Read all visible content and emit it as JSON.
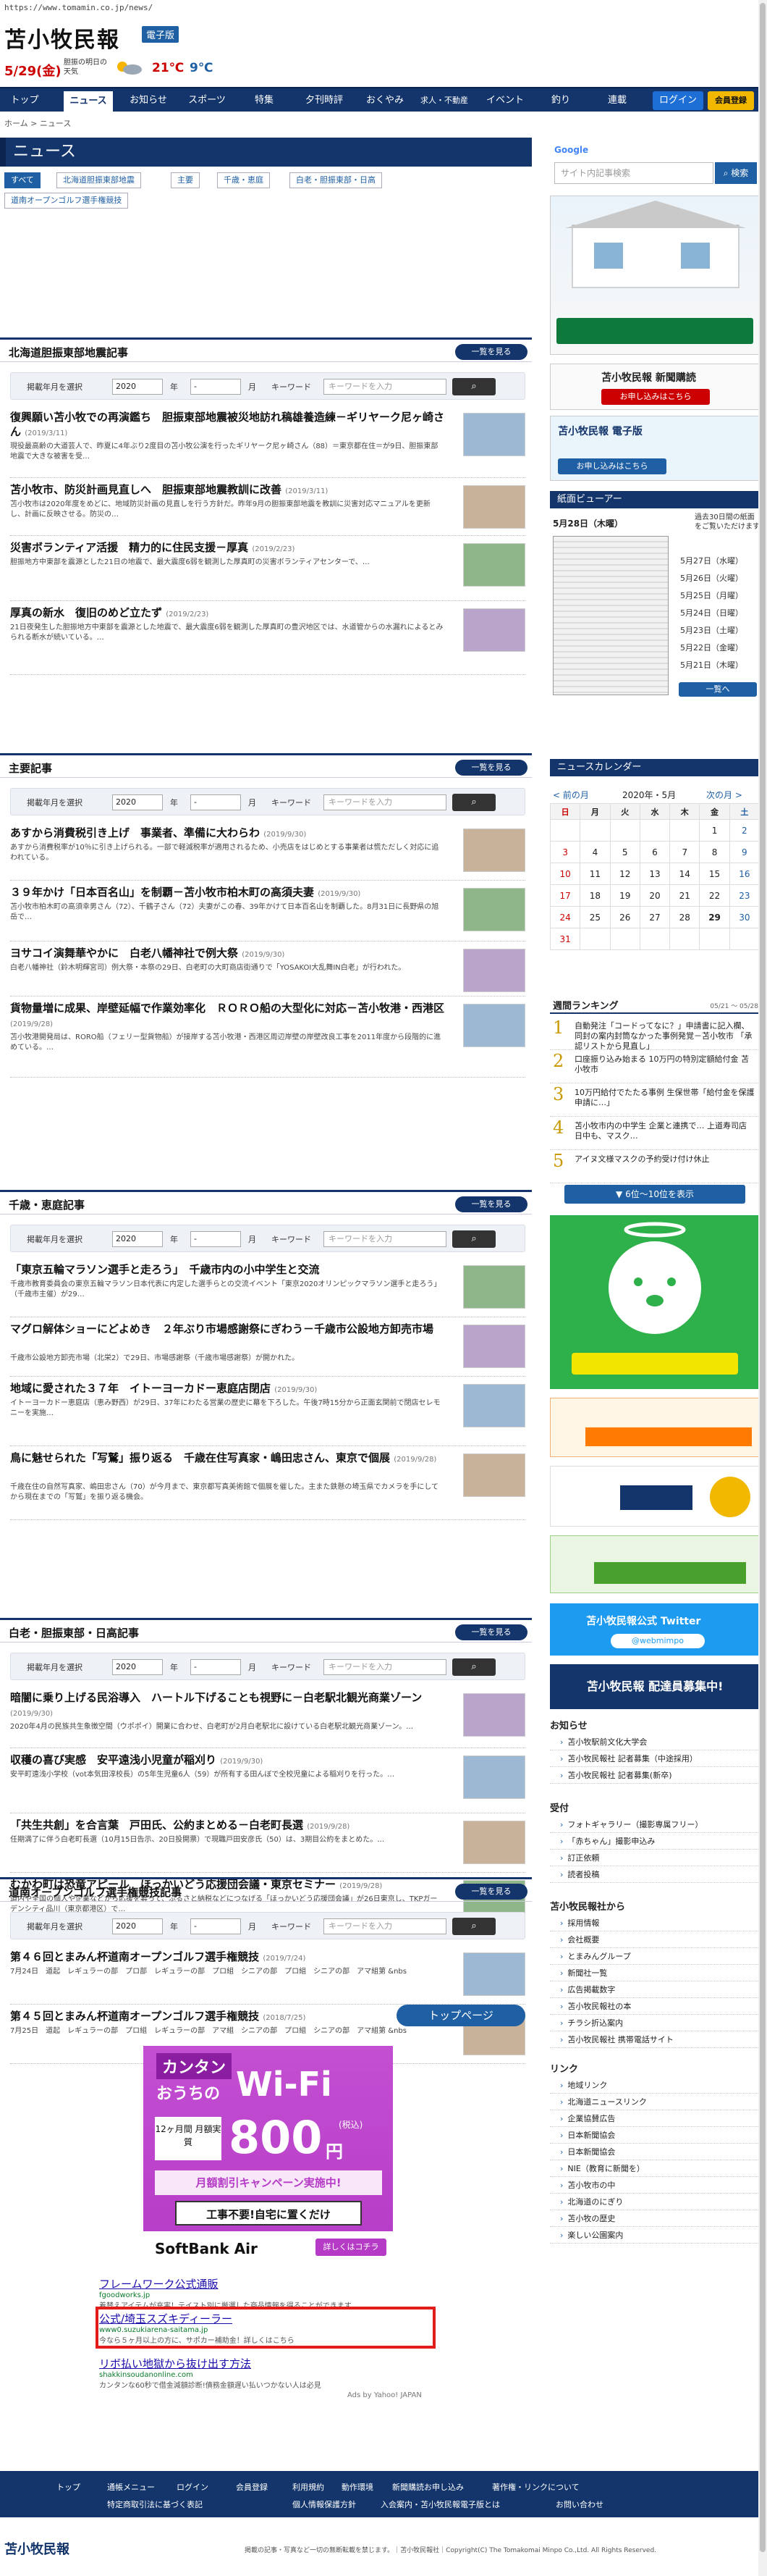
{
  "url": "https://www.tomamin.co.jp/news/",
  "header": {
    "logo": "苫小牧民報",
    "edition": "電子版",
    "date": "5/29(金)",
    "weather_label": "胆振の明日の天気",
    "temp_hi": "21℃",
    "temp_lo": "9℃"
  },
  "nav": [
    "トップ",
    "ニュース",
    "お知らせ",
    "スポーツ",
    "特集",
    "夕刊時評",
    "おくやみ",
    "求人・不動産",
    "イベント",
    "釣り",
    "連載",
    "ログイン",
    "会員登録"
  ],
  "breadcrumb": "ホーム > ニュース",
  "page_title": "ニュース",
  "categories": [
    "すべて",
    "北海道胆振東部地震",
    "主要",
    "千歳・恵庭",
    "白老・胆振東部・日高",
    "道南オープンゴルフ選手権競技"
  ],
  "search": {
    "year_label": "掲載年月を選択",
    "year": "2020",
    "year_unit": "年",
    "month": "-",
    "month_unit": "月",
    "keyword_label": "キーワード",
    "keyword_placeholder": "キーワードを入力",
    "more": "一覧を見る"
  },
  "sections": [
    {
      "title": "北海道胆振東部地震記事",
      "articles": [
        {
          "title": "復興願い苫小牧での再演鑑ち　胆振東部地震被災地訪れ稿雄養造練－ギリヤーク尼ヶ崎さん",
          "date": "(2019/3/11)",
          "body": "現役最高齢の大道芸人で、昨夏に4年ぶり2度目の苫小牧公演を行ったギリヤーク尼ヶ崎さん（88）＝東京都在住＝が9日、胆振東部地震で大きな被害を受…"
        },
        {
          "title": "苫小牧市、防災計画見直しへ　胆振東部地震教訓に改善",
          "date": "(2019/3/11)",
          "body": "苫小牧市は2020年度をめどに、地域防災計画の見直しを行う方針だ。昨年9月の胆振東部地震を教訓に災害対応マニュアルを更新し、計画に反映させる。防災の…"
        },
        {
          "title": "災害ボランティア活援　精力的に住民支援－厚真",
          "date": "(2019/2/23)",
          "body": "胆振地方中東部を震源とした21日の地震で、最大震度6弱を観測した厚真町の災害ボランティアセンターで、…"
        },
        {
          "title": "厚真の新水　復旧のめど立たず",
          "date": "(2019/2/23)",
          "body": "21日夜発生した胆振地方中東部を震源とした地震で、最大震度6弱を観測した厚真町の豊沢地区では、水道管からの水漏れによるとみられる断水が続いている。…"
        }
      ]
    },
    {
      "title": "主要記事",
      "articles": [
        {
          "title": "あすから消費税引き上げ　事業者、準備に大わらわ",
          "date": "(2019/9/30)",
          "body": "あすから消費税率が10％に引き上げられる。一部で軽減税率が適用されるため、小売店をはじめとする事業者は慌ただしく対応に追われている。"
        },
        {
          "title": "３９年かけ「日本百名山」を制覇－苫小牧市柏木町の高須夫妻",
          "date": "(2019/9/30)",
          "body": "苫小牧市柏木町の高須幸男さん（72）、千鶴子さん（72）夫妻がこの春、39年かけて日本百名山を制覇した。8月31日に長野県の旭岳で…"
        },
        {
          "title": "ヨサコイ演舞華やかに　白老八幡神社で例大祭",
          "date": "(2019/9/30)",
          "body": "白老八幡神社（鈴木明輝宮司）例大祭・本祭の29日、白老町の大町商店街通りで「YOSAKOI大乱舞IN白老」が行われた。"
        },
        {
          "title": "貨物量増に成果、岸壁延幅で作業効率化　ＲＯＲＯ船の大型化に対応－苫小牧港・西港区",
          "date": "(2019/9/28)",
          "body": "苫小牧港開発局は、RORO船（フェリー型貨物船）が接岸する苫小牧港・西港区周辺岸壁の岸壁改良工事を2011年度から段階的に進めている。…"
        }
      ]
    },
    {
      "title": "千歳・恵庭記事",
      "articles": [
        {
          "title": "「東京五輪マラソン選手と走ろう」　千歳市内の小中学生と交流",
          "date": "",
          "body": "千歳市教育委員会の東京五輪マラソン日本代表に内定した選手らとの交流イベント「東京2020オリンピックマラソン選手と走ろう」（千歳市主催）が29…"
        },
        {
          "title": "マグロ解体ショーにどよめき　２年ぶり市場感謝祭にぎわう－千歳市公設地方卸売市場",
          "date": "",
          "body": "千歳市公設地方卸売市場（北栄2）で29日、市場感謝祭（千歳市場感謝祭）が開かれた。"
        },
        {
          "title": "地域に愛された３７年　イトーヨーカドー恵庭店閉店",
          "date": "(2019/9/30)",
          "body": "イトーヨーカドー恵庭店（恵み野西）が29日、37年にわたる営業の歴史に幕を下ろした。午後7時15分から正面玄関前で閉店セレモニーを実施…"
        },
        {
          "title": "鳥に魅せられた「写鷲」振り返る　千歳在住写真家・嶋田忠さん、東京で個展",
          "date": "(2019/9/28)",
          "body": "千歳在住の自然写真家、嶋田忠さん（70）が今月まで、東京都写真美術館で個展を催した。主また鉄懸の埼玉県でカメラを手にしてから現在までの「写鷲」を振り返る機会。"
        }
      ]
    },
    {
      "title": "白老・胆振東部・日高記事",
      "articles": [
        {
          "title": "暗闇に乗り上げる民浴導入　ハートル下げることも視野に－白老駅北観光商業ゾーン",
          "date": "(2019/9/30)",
          "body": "2020年4月の民族共生象徴空間（ウポポイ）開業に合わせ、白老町が2月白老駅北に設けている白老駅北観光商業ゾーン。…"
        },
        {
          "title": "収穫の喜び実感　安平遠浅小児童が稲刈り",
          "date": "(2019/9/30)",
          "body": "安平町遠浅小学校（vot本気田淳校長）の5年生児童6人（59）が所有する田んぼで全校児童による稲刈りを行った。…"
        },
        {
          "title": "「共生共創」を合言葉　戸田氏、公約まとめる－白老町長選",
          "date": "(2019/9/28)",
          "body": "任期満了に伴う白老町長選（10月15日告示、20日投開票）で現職戸田安彦氏（50）は、3期目公約をまとめた。…"
        },
        {
          "title": "むかわ町は恐竜アピール　ほっかいどう応援団会議・東京セミナー",
          "date": "(2019/9/28)",
          "body": "道内や全国の個人や企業などから応援を募って、ふるさと納税などにつなげる「ほっかいどう応援団会議」が26日東京し、TKPガーデンシティ品川（東京都港区）で…"
        }
      ]
    },
    {
      "title": "道南オープンゴルフ選手権競技記事",
      "articles": [
        {
          "title": "第４６回とまみん杯道南オープンゴルフ選手権競技",
          "date": "(2019/7/24)",
          "body": "7月24日　道起　レギュラーの部　プロ部　レギュラーの部　プロ組　シニアの部　プロ組　シニアの部　アマ組第 &nbs"
        },
        {
          "title": "第４５回とまみん杯道南オープンゴルフ選手権競技",
          "date": "(2018/7/25)",
          "body": "7月25日　道起　レギュラーの部　プロ組　レギュラーの部　アマ組　シニアの部　プロ組　シニアの部　アマ組第 &nbs"
        }
      ]
    }
  ],
  "page_button": "トップページ",
  "ad_banner": {
    "line1": "カンタン",
    "line2": "おうちの",
    "wifi": "Wi-Fi",
    "badge": "12ヶ月間 月額実質",
    "price": "800",
    "unit": "円",
    "tax": "(税込)",
    "campaign": "月額割引キャンペーン実施中!",
    "note": "工事不要!自宅に置くだけ",
    "brand": "SoftBank Air",
    "cta": "詳しくはコチラ"
  },
  "ad_links": [
    {
      "title": "フレームワーク公式通販",
      "url": "fgoodworks.jp",
      "desc": "着替えアイテムが充実！テイスト別に厳選した商品情報を得ることができます"
    },
    {
      "title": "公式/埼玉スズキディーラー",
      "url": "www0.suzukiarena-saitama.jp",
      "desc": "今なら５ヶ月以上の方に、サポカー補助金！詳しくはこちら"
    },
    {
      "title": "リボ払い地獄から抜け出す方法",
      "url": "shakkinsoudanonline.com",
      "desc": "カンタンな60秒で借金減額診断!債務金額遅い払いつかない人は必見"
    }
  ],
  "ads_by": "Ads by Yahoo! JAPAN",
  "sidebar": {
    "search_placeholder": "サイト内記事検索",
    "search_button": "検索",
    "google": "Google",
    "subscribe_title": "苫小牧民報 新聞購読",
    "subscribe_cta": "お申し込みはこちら",
    "dsub_title": "苫小牧民報 電子版",
    "dsub_cta": "お申し込みはこちら",
    "viewer_head": "紙面ビューアー",
    "viewer_date": "5月28日（木曜）",
    "viewer_note": "過去30日間の紙面をご覧いただけます",
    "viewer_dates": [
      "5月27日（水曜）",
      "5月26日（火曜）",
      "5月25日（月曜）",
      "5月24日（日曜）",
      "5月23日（土曜）",
      "5月22日（金曜）",
      "5月21日（木曜）"
    ],
    "viewer_more": "一覧へ",
    "cal_head": "ニュースカレンダー",
    "cal_prev": "< 前の月",
    "cal_month": "2020年・5月",
    "cal_next": "次の月 >",
    "cal_days": [
      "日",
      "月",
      "火",
      "水",
      "木",
      "金",
      "土"
    ],
    "cal_weeks": [
      [
        "",
        "",
        "",
        "",
        "",
        "1",
        "2"
      ],
      [
        "3",
        "4",
        "5",
        "6",
        "7",
        "8",
        "9"
      ],
      [
        "10",
        "11",
        "12",
        "13",
        "14",
        "15",
        "16"
      ],
      [
        "17",
        "18",
        "19",
        "20",
        "21",
        "22",
        "23"
      ],
      [
        "24",
        "25",
        "26",
        "27",
        "28",
        "29",
        "30"
      ],
      [
        "31",
        "",
        "",
        "",
        "",
        "",
        ""
      ]
    ],
    "rank_head": "週間ランキング",
    "rank_period": "05/21 〜 05/28",
    "ranking": [
      "自動発注「コードってなに？」申請書に記入欄、同封の案内封筒なかった事例発覚－苫小牧市 「承認リストから見直し」",
      "口座振り込み始まる 10万円の特別定額給付金 苫小牧市",
      "10万円給付でたたる事例 生保世帯「給付金を保護申請に…」",
      "苫小牧市内の中学生 企業と連携で…  上道寿司店 日中も、マスク…",
      "アイヌ文様マスクの予約受け付け休止"
    ],
    "rank_more": "6位〜10位を表示",
    "twitter_title": "苫小牧民報公式 Twitter",
    "twitter_handle": "@webmimpo",
    "hiring": "苫小牧民報 配達員募集中!",
    "info_head": "お知らせ",
    "info_items": [
      "苫小牧駅前文化大学会",
      "苫小牧民報社 記者募集（中途採用）",
      "苫小牧民報社 記者募集(新卒)"
    ],
    "uketsuke_head": "受付",
    "uketsuke_items": [
      "フォトギャラリー（撮影専属フリー）",
      "「赤ちゃん」撮影申込み",
      "訂正依頼",
      "読者投稿"
    ],
    "company_head": "苫小牧民報社から",
    "company_items": [
      "採用情報",
      "会社概要",
      "とまみんグループ",
      "新聞社一覧",
      "広告掲載数字",
      "苫小牧民報社の本",
      "チラシ折込案内",
      "苫小牧民報社 携帯電話サイト"
    ],
    "link_head": "リンク",
    "link_items": [
      "地域リンク",
      "北海道ニュースリンク",
      "企業協賛広告",
      "日本新聞協会",
      "日本新聞協会",
      "NIE（教育に新聞を）",
      "苫小牧市の中",
      "北海道のにぎり",
      "苫小牧の歴史",
      "楽しい公園案内"
    ]
  },
  "footer": {
    "nav1": [
      "トップ",
      "通帳メニュー",
      "ログイン",
      "会員登録",
      "利用規約",
      "動作環境",
      "新聞購読お申し込み",
      "著作権・リンクについて"
    ],
    "nav2": [
      "特定商取引法に基づく表記",
      "個人情報保護方針",
      "入会案内・苫小牧民報電子版とは",
      "お問い合わせ"
    ],
    "logo": "苫小牧民報",
    "copyright": "掲載の記事・写真など一切の無断転載を禁じます。｜苫小牧民報社｜Copyright(C) The Tomakomai Minpo Co.,Ltd. All Rights Reserved."
  },
  "colors": {
    "brand": "#13356b",
    "accent": "#1f5fa3",
    "red": "#e21b1b"
  }
}
